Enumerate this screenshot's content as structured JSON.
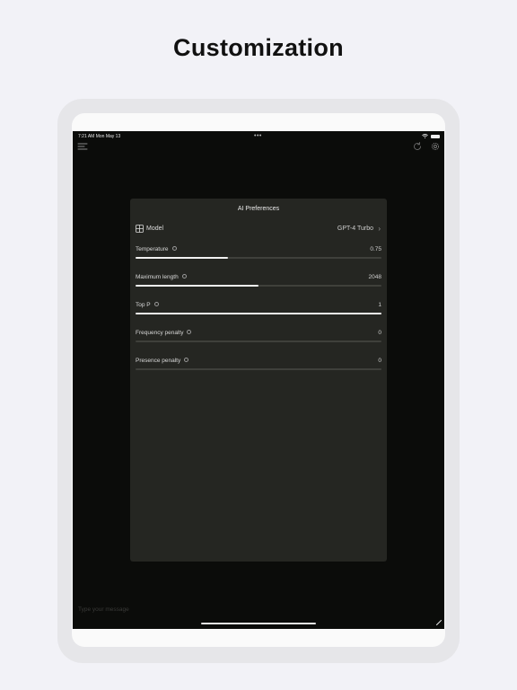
{
  "headline": "Customization",
  "status_bar": {
    "time_date": "7:21 AM   Mon May 13",
    "multitask": "•••"
  },
  "icons": {
    "menu": "hamburger-menu-icon",
    "refresh": "refresh-icon",
    "settings": "gear-icon",
    "model": "grid-icon",
    "chevron": "chevron-right-icon",
    "info": "info-icon"
  },
  "panel": {
    "title": "AI Preferences",
    "model": {
      "label": "Model",
      "value": "GPT-4 Turbo",
      "chevron": "›"
    },
    "params": [
      {
        "label": "Temperature",
        "value": "0.75",
        "fraction": 0.375
      },
      {
        "label": "Maximum length",
        "value": "2048",
        "fraction": 0.5
      },
      {
        "label": "Top P",
        "value": "1",
        "fraction": 1.0
      },
      {
        "label": "Frequency penalty",
        "value": "0",
        "fraction": 0
      },
      {
        "label": "Presence penalty",
        "value": "0",
        "fraction": 0
      }
    ]
  },
  "composer": {
    "placeholder": "Type your message"
  },
  "colors": {
    "page_bg": "#f2f2f7",
    "screen_bg": "#0b0c0a",
    "panel_bg": "#252622",
    "slider_fill": "#f1f1f1",
    "slider_track": "#3f403b"
  }
}
